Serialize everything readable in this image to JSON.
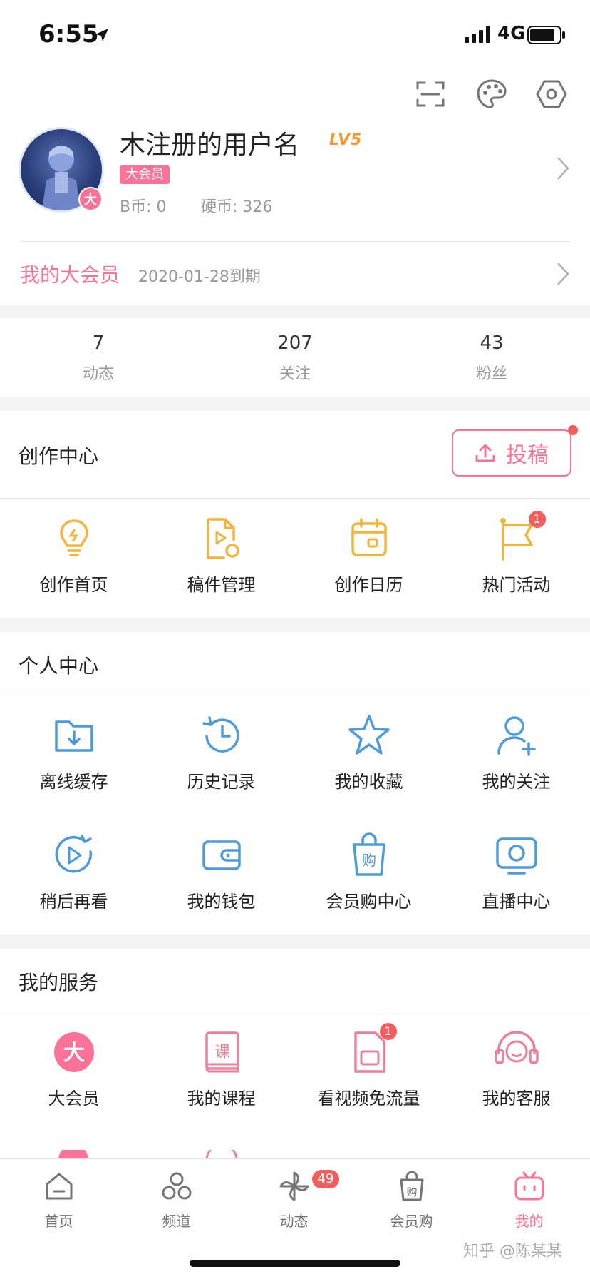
{
  "status": {
    "time": "6:55",
    "network": "4G"
  },
  "profile": {
    "username": "木注册的用户名",
    "level": "LV5",
    "vip_tag": "大会员",
    "avatar_badge": "大",
    "b_coin": "B币: 0",
    "hard_coin": "硬币: 326",
    "vip_row_label": "我的大会员",
    "vip_row_date": "2020-01-28到期"
  },
  "header_icons": [
    "scan-icon",
    "palette-icon",
    "settings-icon"
  ],
  "stats": [
    {
      "value": "7",
      "label": "动态"
    },
    {
      "value": "207",
      "label": "关注"
    },
    {
      "value": "43",
      "label": "粉丝"
    }
  ],
  "creation": {
    "title": "创作中心",
    "upload_label": "投稿",
    "items": [
      {
        "label": "创作首页",
        "icon": "bulb-icon"
      },
      {
        "label": "稿件管理",
        "icon": "manuscript-icon"
      },
      {
        "label": "创作日历",
        "icon": "calendar-icon"
      },
      {
        "label": "热门活动",
        "icon": "flag-icon",
        "badge": "1"
      }
    ]
  },
  "personal": {
    "title": "个人中心",
    "items": [
      {
        "label": "离线缓存",
        "icon": "download-folder-icon"
      },
      {
        "label": "历史记录",
        "icon": "history-icon"
      },
      {
        "label": "我的收藏",
        "icon": "star-icon"
      },
      {
        "label": "我的关注",
        "icon": "add-user-icon"
      },
      {
        "label": "稍后再看",
        "icon": "watch-later-icon"
      },
      {
        "label": "我的钱包",
        "icon": "wallet-icon"
      },
      {
        "label": "会员购中心",
        "icon": "shopping-bag-icon"
      },
      {
        "label": "直播中心",
        "icon": "live-tv-icon"
      }
    ]
  },
  "services": {
    "title": "我的服务",
    "items": [
      {
        "label": "大会员",
        "icon": "vip-icon",
        "glyph": "大"
      },
      {
        "label": "我的课程",
        "icon": "course-book-icon",
        "glyph": "课"
      },
      {
        "label": "看视频免流量",
        "icon": "sim-card-icon",
        "badge": "1"
      },
      {
        "label": "我的客服",
        "icon": "headset-icon"
      }
    ]
  },
  "tabbar": [
    {
      "label": "首页",
      "icon": "home-icon"
    },
    {
      "label": "频道",
      "icon": "channel-icon"
    },
    {
      "label": "动态",
      "icon": "dynamic-pinwheel-icon",
      "badge": "49"
    },
    {
      "label": "会员购",
      "icon": "shop-bag-icon",
      "glyph": "购"
    },
    {
      "label": "我的",
      "icon": "tv-mine-icon"
    }
  ],
  "watermark": "知乎 @陈某某",
  "colors": {
    "pink": "#fb7299",
    "gold": "#f2b43c",
    "blue": "#4f9bd9",
    "red": "#f25d5d"
  }
}
